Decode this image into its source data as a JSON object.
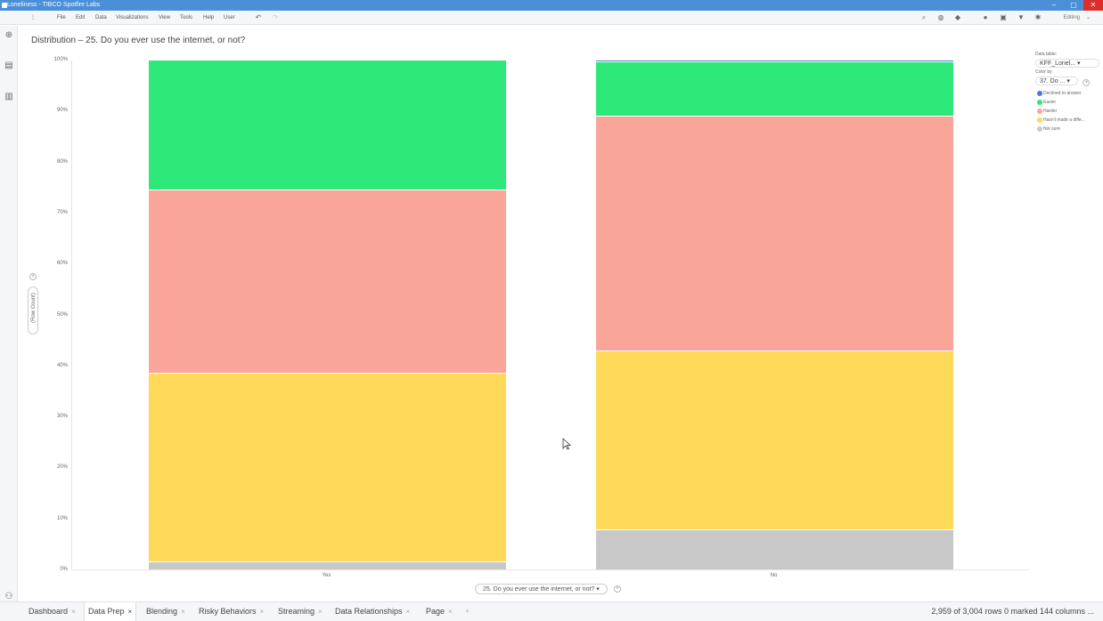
{
  "window": {
    "title": "Loneliness - TIBCO Spotfire Labs",
    "min": "–",
    "max": "▢",
    "close": "✕"
  },
  "menu": {
    "items": [
      "File",
      "Edit",
      "Data",
      "Visualizations",
      "View",
      "Tools",
      "Help",
      "User"
    ],
    "mode": "Editing"
  },
  "viz": {
    "title": "Distribution – 25. Do you ever use the internet, or not?",
    "y_axis_selector": "(Row Count)",
    "x_axis_selector": "25. Do you ever use the internet, or not?"
  },
  "legend": {
    "data_table_label": "Data table:",
    "data_table_value": "KFF_Lonel...",
    "color_by_label": "Color by",
    "color_by_value": "37. Do ...",
    "items": [
      {
        "label": "Declined to answer",
        "color": "#4a78d6"
      },
      {
        "label": "Easier",
        "color": "#2ee87a"
      },
      {
        "label": "Harder",
        "color": "#f9a59a"
      },
      {
        "label": "Hasn't made a diffe...",
        "color": "#ffd95a"
      },
      {
        "label": "Not sure",
        "color": "#c8c8c8"
      }
    ]
  },
  "chart_data": {
    "type": "bar",
    "stacked": true,
    "percent": true,
    "categories": [
      "Yes",
      "No"
    ],
    "series": [
      {
        "name": "Not sure",
        "color": "#c8c8c8",
        "values": [
          1.6,
          7.9
        ]
      },
      {
        "name": "Hasn't made a diffe...",
        "color": "#ffd95a",
        "values": [
          36.9,
          35.0
        ]
      },
      {
        "name": "Harder",
        "color": "#f9a59a",
        "values": [
          36.0,
          46.1
        ]
      },
      {
        "name": "Easier",
        "color": "#2ee87a",
        "values": [
          25.5,
          10.6
        ]
      },
      {
        "name": "Declined to answer",
        "color": "#4a78d6",
        "values": [
          0.0,
          0.4
        ]
      }
    ],
    "ylim": [
      0,
      100
    ],
    "yticks": [
      "0%",
      "10%",
      "20%",
      "30%",
      "40%",
      "50%",
      "60%",
      "70%",
      "80%",
      "90%",
      "100%"
    ]
  },
  "tabs": [
    {
      "label": "Dashboard",
      "active": false
    },
    {
      "label": "Data Prep",
      "active": true
    },
    {
      "label": "Blending",
      "active": false
    },
    {
      "label": "Risky Behaviors",
      "active": false
    },
    {
      "label": "Streaming",
      "active": false
    },
    {
      "label": "Data Relationships",
      "active": false
    },
    {
      "label": "Page",
      "active": false
    }
  ],
  "status": "2,959 of 3,004 rows 0 marked 144 columns ..."
}
